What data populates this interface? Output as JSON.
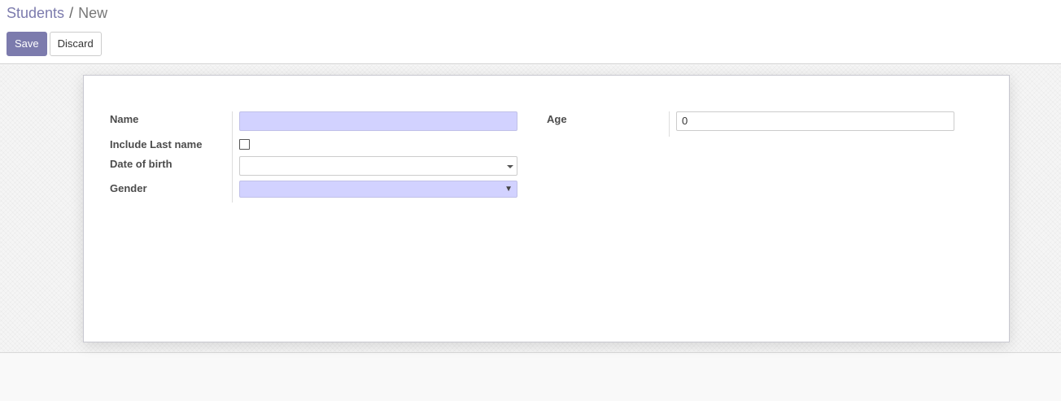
{
  "breadcrumb": {
    "parent": "Students",
    "separator": "/",
    "current": "New"
  },
  "toolbar": {
    "save_label": "Save",
    "discard_label": "Discard"
  },
  "form": {
    "name": {
      "label": "Name",
      "value": ""
    },
    "include_last_name": {
      "label": "Include Last name",
      "checked": false
    },
    "date_of_birth": {
      "label": "Date of birth",
      "value": ""
    },
    "gender": {
      "label": "Gender",
      "value": ""
    },
    "age": {
      "label": "Age",
      "value": "0"
    }
  },
  "colors": {
    "brand": "#7c7bad",
    "required_field": "#d2d2ff"
  }
}
